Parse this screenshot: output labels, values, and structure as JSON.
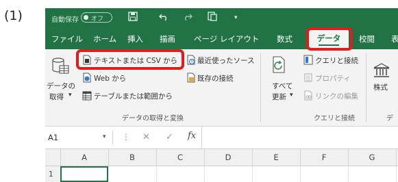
{
  "step_label": "(1)",
  "title_bar": {
    "autosave_label": "自動保存",
    "autosave_state": "オフ",
    "save_icon": "floppy-disk-icon",
    "undo_icon": "undo-icon",
    "redo_icon": "redo-icon",
    "extra_icon": "touch-mode-icon",
    "more_icon": "customize-arrow-icon"
  },
  "tabs": [
    {
      "label": "ファイル"
    },
    {
      "label": "ホーム"
    },
    {
      "label": "挿入"
    },
    {
      "label": "描画"
    },
    {
      "label": "ページ レイアウト"
    },
    {
      "label": "数式"
    },
    {
      "label": "データ",
      "active": true
    },
    {
      "label": "校閲"
    },
    {
      "label": "表"
    }
  ],
  "ribbon": {
    "get_data": {
      "line1": "データの",
      "line2": "取得",
      "dropdown": "▾"
    },
    "from_text_csv": "テキストまたは CSV から",
    "from_web": "Web から",
    "from_table_range": "テーブルまたは範囲から",
    "recent_sources": "最近使ったソース",
    "existing_connections": "既存の接続",
    "group_get_transform": "データの取得と変換",
    "refresh_all": {
      "line1": "すべて",
      "line2": "更新",
      "dropdown": "▾"
    },
    "queries_connections": "クエリと接続",
    "properties": "プロパティ",
    "edit_links": "リンクの編集",
    "group_queries": "クエリと接続",
    "stocks": "株式",
    "group_data_types": "デー"
  },
  "formula_bar": {
    "name_box": "A1",
    "name_dropdown": "▾",
    "dots": "⋮",
    "cancel": "✕",
    "enter": "✓",
    "fx": "fx"
  },
  "grid": {
    "columns": [
      "A",
      "B",
      "C",
      "D",
      "E",
      "F",
      "G"
    ],
    "rows": [
      "1"
    ],
    "selected_cell": "A1"
  },
  "colors": {
    "excel_green": "#217346",
    "highlight_red": "#e21b1b"
  }
}
